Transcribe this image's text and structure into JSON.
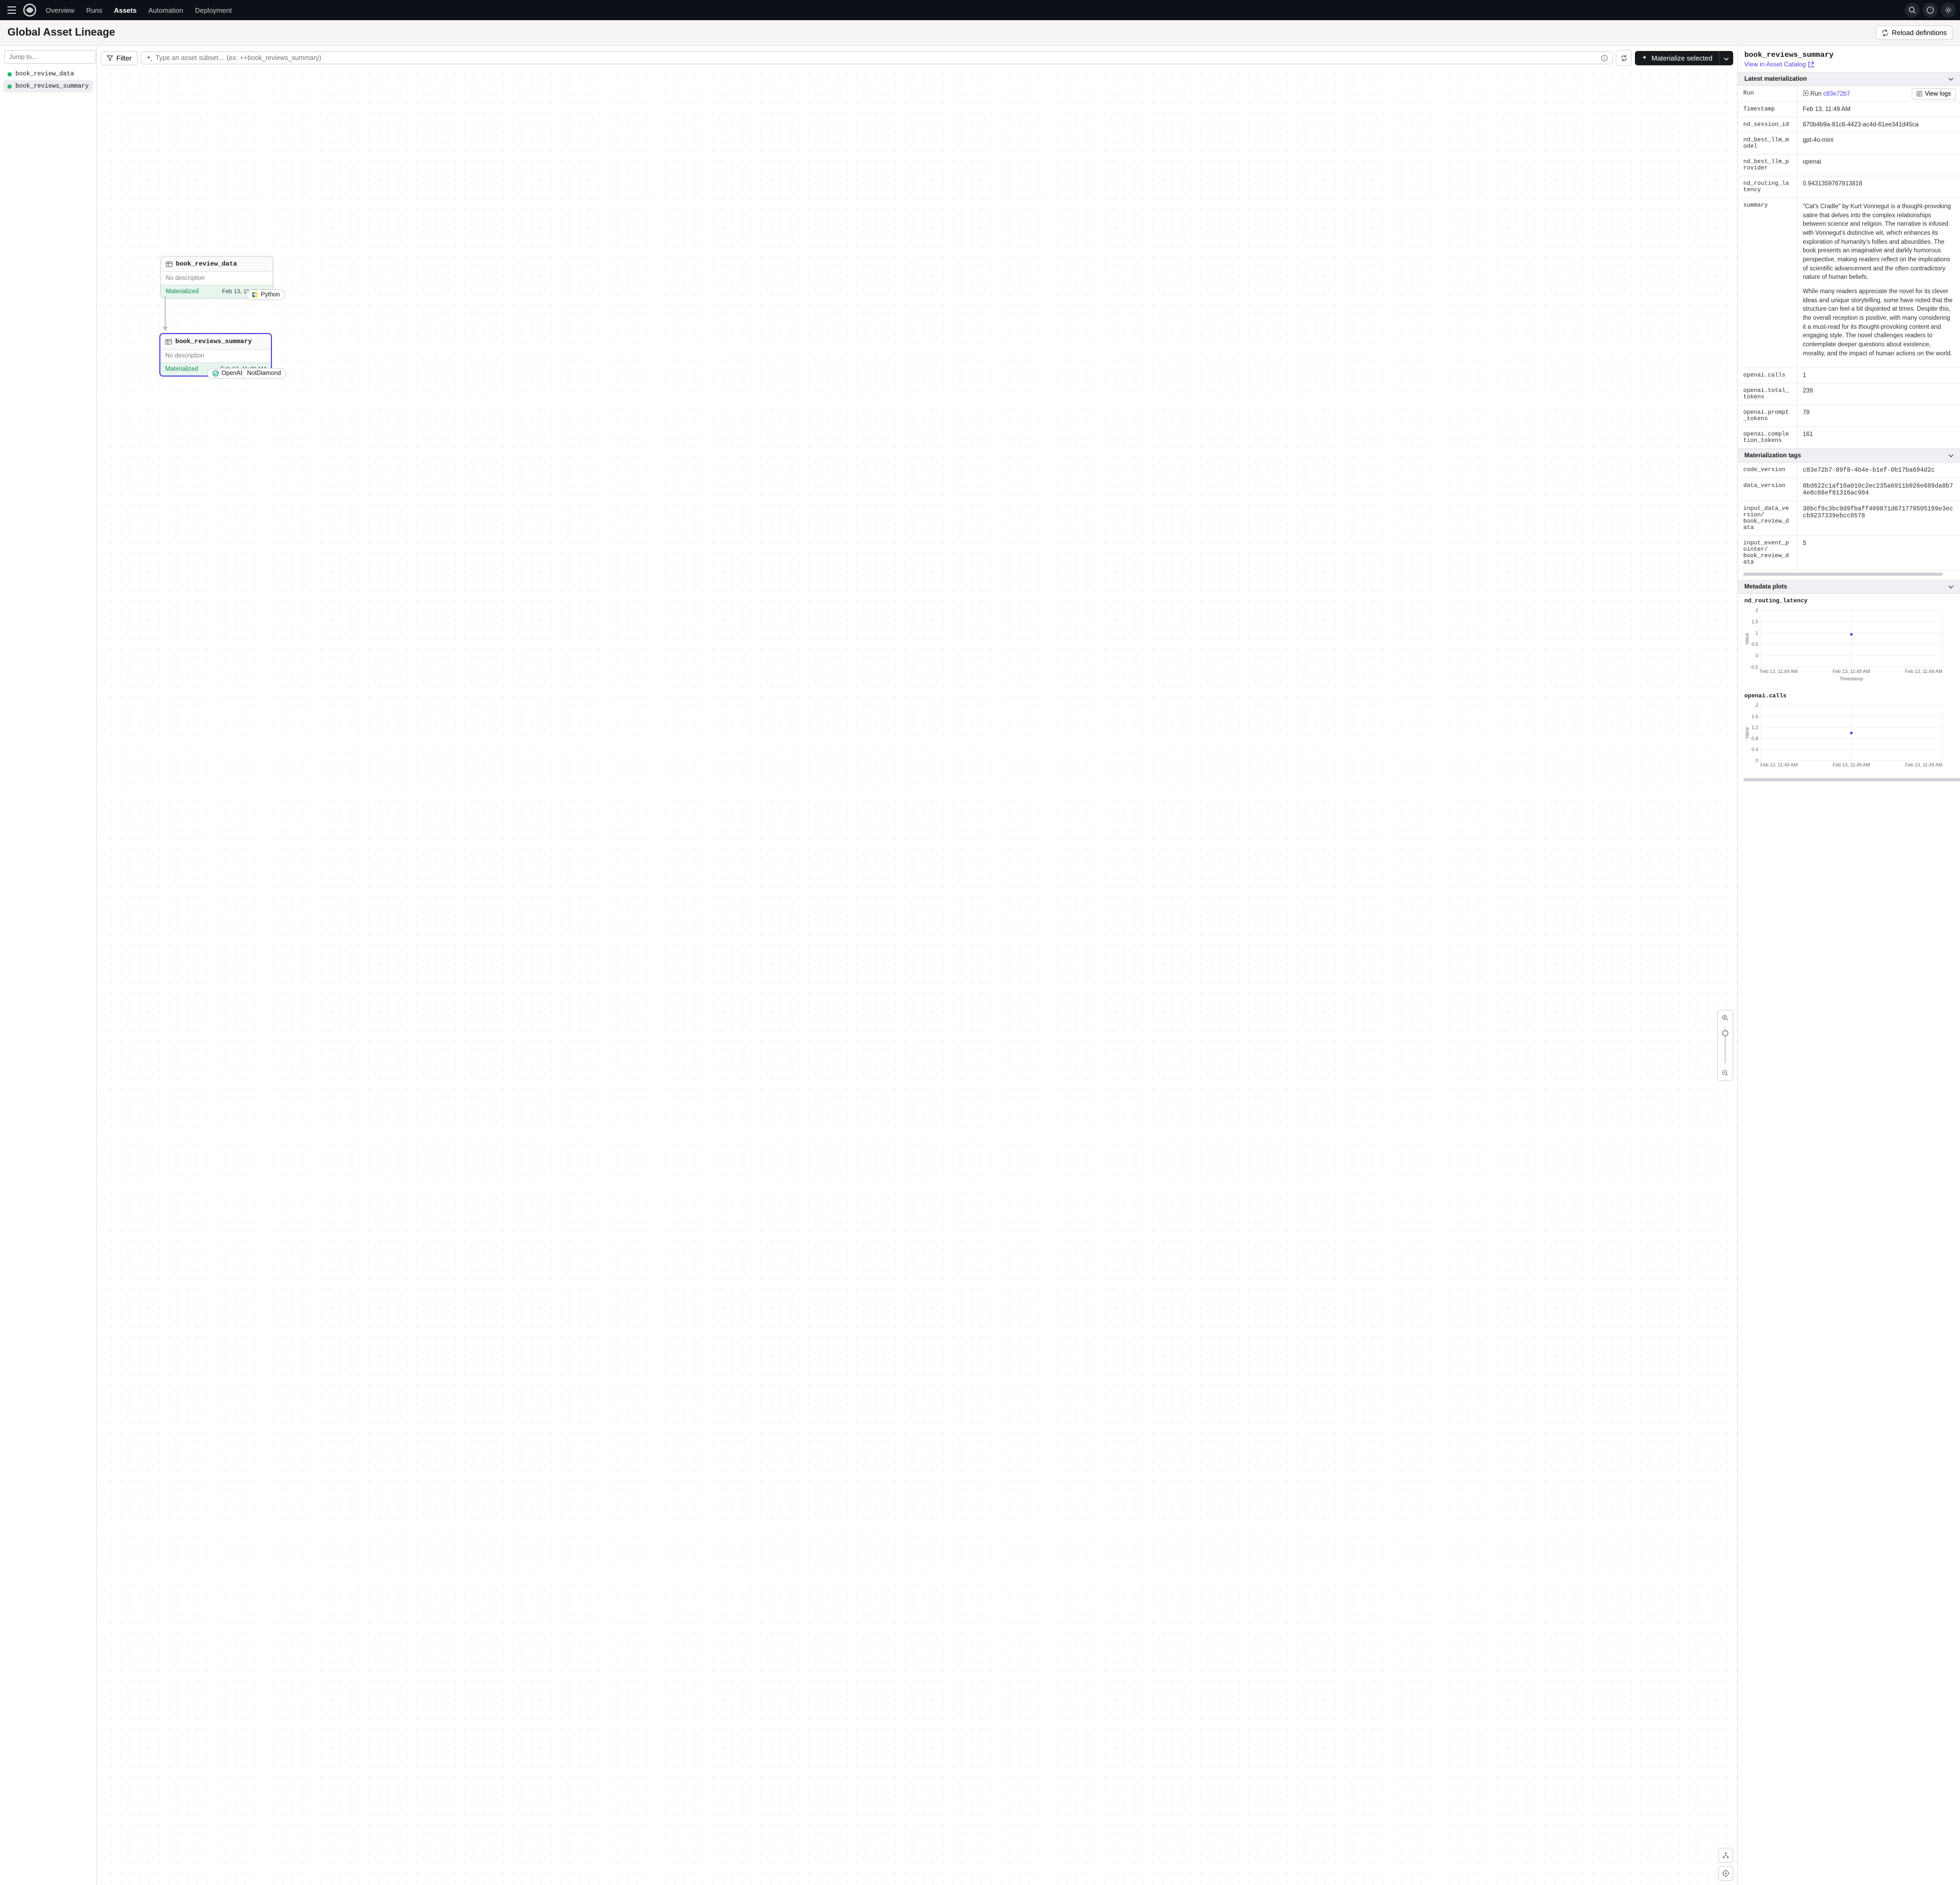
{
  "topnav": {
    "links": [
      "Overview",
      "Runs",
      "Assets",
      "Automation",
      "Deployment"
    ],
    "active_index": 2
  },
  "page_title": "Global Asset Lineage",
  "reload_label": "Reload definitions",
  "left": {
    "jump_placeholder": "Jump to…",
    "assets": [
      {
        "name": "book_review_data",
        "selected": false
      },
      {
        "name": "book_reviews_summary",
        "selected": true
      }
    ]
  },
  "toolbar": {
    "filter_label": "Filter",
    "subset_placeholder": "Type an asset subset… (ex: ++book_reviews_summary)",
    "materialize_label": "Materialize selected"
  },
  "graph": {
    "node1": {
      "title": "book_review_data",
      "desc": "No description",
      "status": "Materialized",
      "ts": "Feb 13, 11:49 AM",
      "tag": "Python"
    },
    "node2": {
      "title": "book_reviews_summary",
      "desc": "No description",
      "status": "Materialized",
      "ts": "Feb 13, 11:49 AM",
      "tag1": "OpenAI",
      "tag2": "NotDiamond"
    }
  },
  "details": {
    "title": "book_reviews_summary",
    "catalog_link": "View in Asset Catalog",
    "section_latest": "Latest materialization",
    "run_label": "Run",
    "run_prefix": "Run ",
    "run_id": "c83e72b7",
    "viewlogs_label": "View logs",
    "rows": [
      {
        "k": "Timestamp",
        "v": "Feb 13, 11:49 AM"
      },
      {
        "k": "nd_session_id",
        "v": "870b4b9a-81c6-4423-ac4d-61ee341d45ca"
      },
      {
        "k": "nd_best_llm_model",
        "v": "gpt-4o-mini"
      },
      {
        "k": "nd_best_llm_provider",
        "v": "openai"
      },
      {
        "k": "nd_routing_latency",
        "v": "0.9431359767913818"
      }
    ],
    "summary_key": "summary",
    "summary_p1": "\"Cat's Cradle\" by Kurt Vonnegut is a thought-provoking satire that delves into the complex relationships between science and religion. The narrative is infused with Vonnegut's distinctive wit, which enhances its exploration of humanity's follies and absurdities. The book presents an imaginative and darkly humorous perspective, making readers reflect on the implications of scientific advancement and the often contradictory nature of human beliefs.",
    "summary_p2": "While many readers appreciate the novel for its clever ideas and unique storytelling, some have noted that the structure can feel a bit disjointed at times. Despite this, the overall reception is positive, with many considering it a must-read for its thought-provoking content and engaging style. The novel challenges readers to contemplate deeper questions about existence, morality, and the impact of human actions on the world.",
    "rows2": [
      {
        "k": "openai.calls",
        "v": "1"
      },
      {
        "k": "openai.total_tokens",
        "v": "239"
      },
      {
        "k": "openai.prompt_tokens",
        "v": "78"
      },
      {
        "k": "openai.completion_tokens",
        "v": "161"
      }
    ],
    "section_tags": "Materialization tags",
    "tag_rows": [
      {
        "k": "code_version",
        "v": "c83e72b7-89f8-4b4e-b1ef-0b17ba694d2c"
      },
      {
        "k": "data_version",
        "v": "0bd622c1af10a010c2ec235a6911b026e689da8b74e8c66ef81316ac904"
      },
      {
        "k": "input_data_version/\nbook_review_data",
        "v": "30bcf8c3bc9d9fbaff409871d671779505199e3eccb9237339ebcc0578"
      },
      {
        "k": "input_event_pointer/\nbook_review_data",
        "v": "5"
      }
    ],
    "section_plots": "Metadata plots",
    "plot1_title": "nd_routing_latency",
    "plot2_title": "openai.calls",
    "axis_x": "Timestamp",
    "axis_y": "Value"
  },
  "chart_data": [
    {
      "type": "scatter",
      "title": "nd_routing_latency",
      "xlabel": "Timestamp",
      "ylabel": "Value",
      "x": [
        "Feb 13, 11:49 AM",
        "Feb 13, 11:49 AM",
        "Feb 13, 11:49 AM"
      ],
      "y_ticks": [
        -0.5,
        0,
        0.5,
        1.0,
        1.5,
        2.0
      ],
      "ylim": [
        -0.5,
        2.0
      ],
      "series": [
        {
          "name": "nd_routing_latency",
          "values": [
            null,
            0.94,
            null
          ]
        }
      ]
    },
    {
      "type": "scatter",
      "title": "openai.calls",
      "xlabel": "Timestamp",
      "ylabel": "Value",
      "x": [
        "Feb 13, 11:49 AM",
        "Feb 13, 11:49 AM",
        "Feb 13, 11:49 AM"
      ],
      "y_ticks": [
        0,
        0.4,
        0.8,
        1.2,
        1.6,
        2.0
      ],
      "ylim": [
        0,
        2.0
      ],
      "series": [
        {
          "name": "openai.calls",
          "values": [
            null,
            1,
            null
          ]
        }
      ]
    }
  ]
}
